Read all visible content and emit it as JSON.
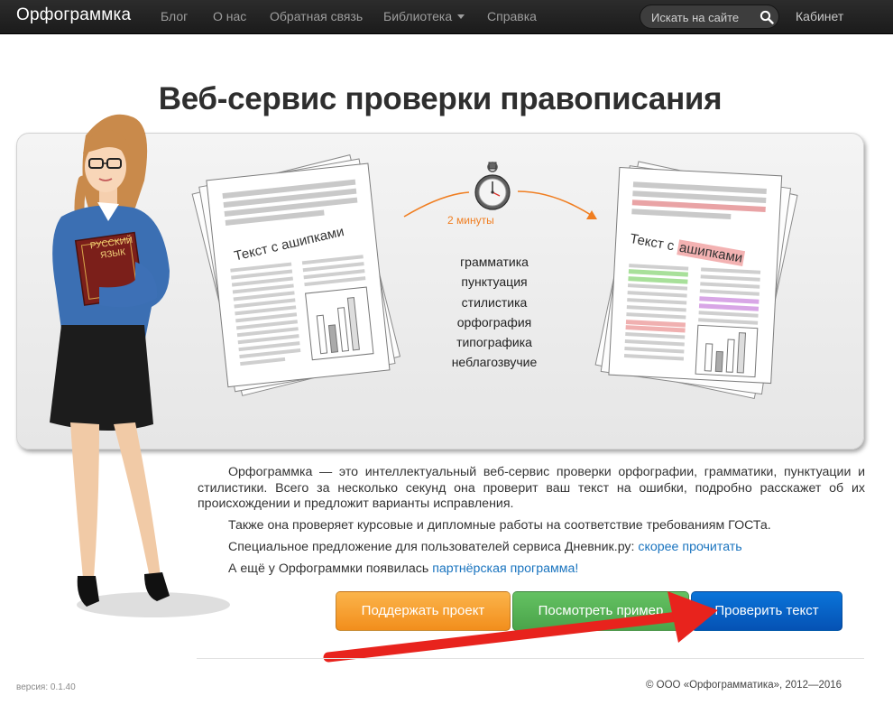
{
  "navbar": {
    "brand": "Орфограммка",
    "links": [
      "Блог",
      "О нас",
      "Обратная связь",
      "Библиотека",
      "Справка"
    ],
    "search_placeholder": "Искать на сайте",
    "cabinet": "Кабинет"
  },
  "page_title": "Веб-сервис проверки правописания",
  "illustration": {
    "time": "2 минуты",
    "checks": [
      "грамматика",
      "пунктуация",
      "стилистика",
      "орфография",
      "типографика",
      "неблагозвучие"
    ],
    "doc_before": "Текст с ашипками",
    "doc_after_prefix": "Текст с",
    "doc_after_error": "ашипками",
    "book_line1": "РУССКИЙ",
    "book_line2": "ЯЗЫК"
  },
  "content": {
    "intro": "Орфограммка — это интеллектуальный веб-сервис проверки орфографии, грамматики, пунктуации и стилистики. Всего за несколько секунд она проверит ваш текст на ошибки, подробно расскажет об их происхождении и предложит варианты исправления.",
    "gost": "Также она проверяет курсовые и дипломные работы на соответствие требованиям ГОСТа.",
    "offer_text": "Специальное предложение для пользователей сервиса Дневник.ру: ",
    "offer_link": "скорее прочитать",
    "partner_text": "А ещё у Орфограммки появилась ",
    "partner_link": "партнёрская программа!"
  },
  "buttons": {
    "support": "Поддержать проект",
    "example": "Посмотреть пример",
    "check": "Проверить текст"
  },
  "footer": {
    "version": "версия: 0.1.40",
    "copyright": "© ООО «Орфограмматика», 2012—2016"
  },
  "colors": {
    "navbar": "#222222",
    "accent_orange": "#f28e1c",
    "accent_green": "#4aa44a",
    "accent_blue": "#0552b4",
    "link": "#1a74bf",
    "annotation_arrow": "#e8231d"
  }
}
